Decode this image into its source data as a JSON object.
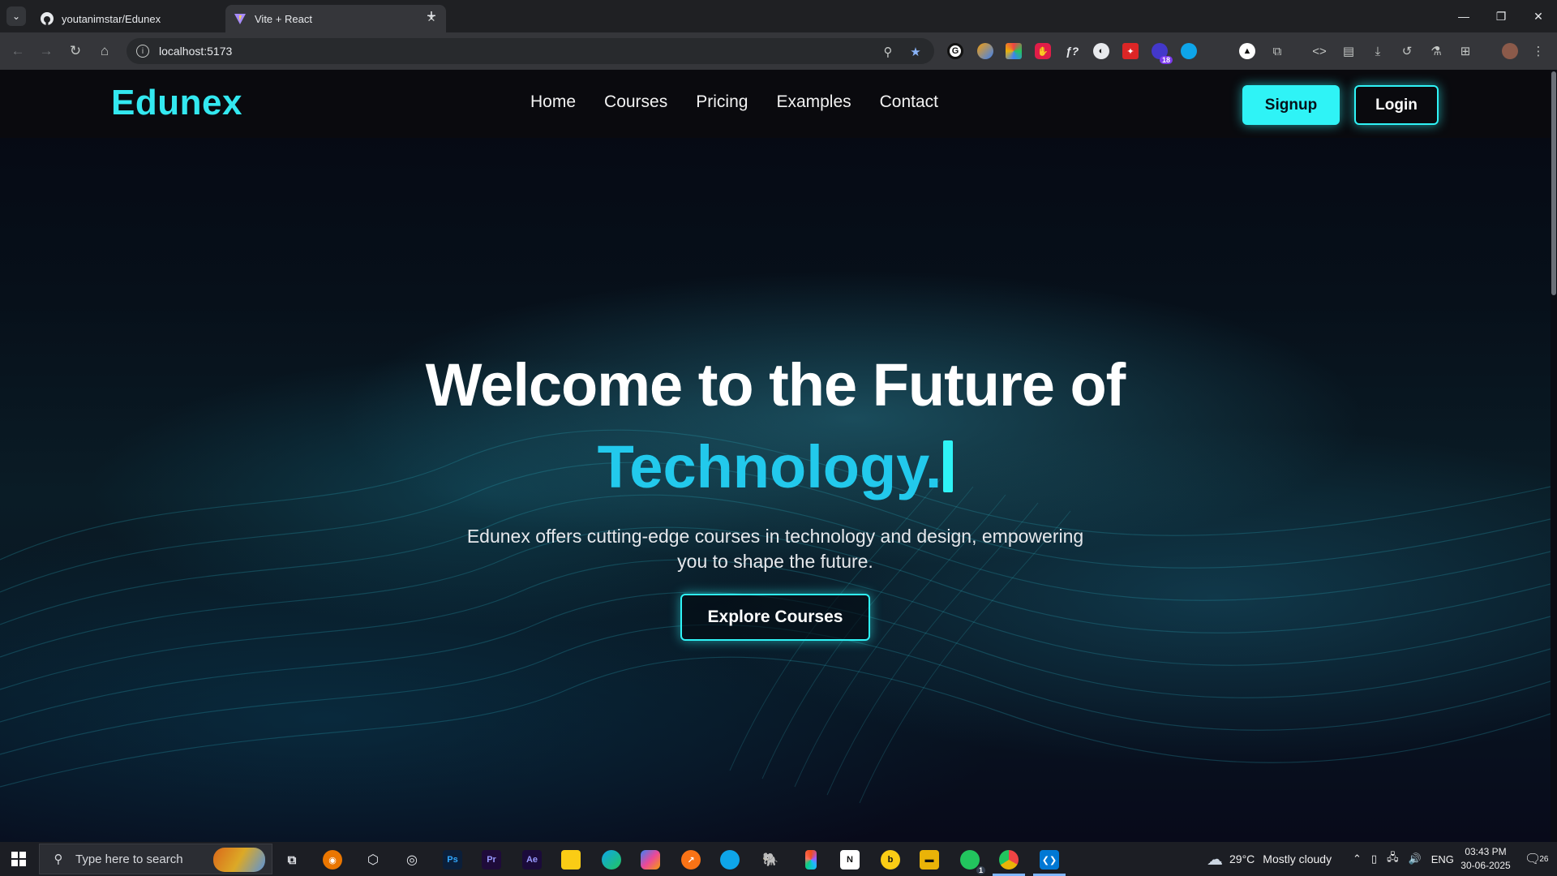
{
  "browser": {
    "tabs": [
      {
        "title": "youtanimstar/Edunex",
        "favicon": "github-icon",
        "active": false
      },
      {
        "title": "Vite + React",
        "favicon": "vite-icon",
        "active": true
      }
    ],
    "address": "localhost:5173",
    "extension_badge": "18"
  },
  "site": {
    "logo": "Edunex",
    "nav": [
      "Home",
      "Courses",
      "Pricing",
      "Examples",
      "Contact"
    ],
    "signup_label": "Signup",
    "login_label": "Login",
    "accent_color": "#2ff3f6"
  },
  "hero": {
    "title": "Welcome to the Future of",
    "typed_word": "Technology.",
    "subtitle_line1": "Edunex offers cutting-edge courses in technology and design, empowering",
    "subtitle_line2": "you to shape the future.",
    "cta_label": "Explore Courses"
  },
  "taskbar": {
    "search_placeholder": "Type here to search",
    "weather_temp": "29°C",
    "weather_text": "Mostly cloudy",
    "language": "ENG",
    "time": "03:43 PM",
    "date": "30-06-2025",
    "notification_count": "26",
    "whatsapp_badge": "1"
  }
}
